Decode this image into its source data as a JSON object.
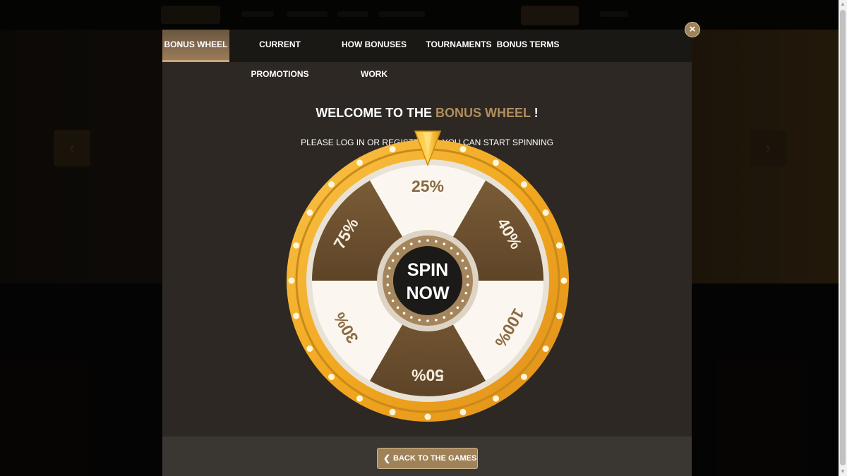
{
  "tabs": [
    {
      "label": "BONUS WHEEL"
    },
    {
      "label": "CURRENT PROMOTIONS"
    },
    {
      "label": "HOW BONUSES WORK"
    },
    {
      "label": "TOURNAMENTS"
    },
    {
      "label": "BONUS TERMS"
    }
  ],
  "active_tab": "BONUS WHEEL",
  "close_icon": "×",
  "welcome": {
    "prefix": "WELCOME TO THE ",
    "highlight": "BONUS WHEEL",
    "suffix": " !"
  },
  "subtitle": "PLEASE LOG IN OR REGISTER SO YOU CAN START SPINNING",
  "wheel": {
    "segments": [
      {
        "label": "25%",
        "style": "light"
      },
      {
        "label": "40%",
        "style": "dark"
      },
      {
        "label": "100%",
        "style": "light"
      },
      {
        "label": "50%",
        "style": "dark"
      },
      {
        "label": "30%",
        "style": "light"
      },
      {
        "label": "75%",
        "style": "dark"
      }
    ],
    "spin_line1": "SPIN",
    "spin_line2": "NOW"
  },
  "footer": {
    "back_label": "BACK TO THE GAMES",
    "back_icon": "chevron-left-icon"
  },
  "colors": {
    "accent": "#b08d5e",
    "gold": "#f2a81f",
    "segment_dark": "#6e5230",
    "segment_light": "#fbf7f0"
  }
}
